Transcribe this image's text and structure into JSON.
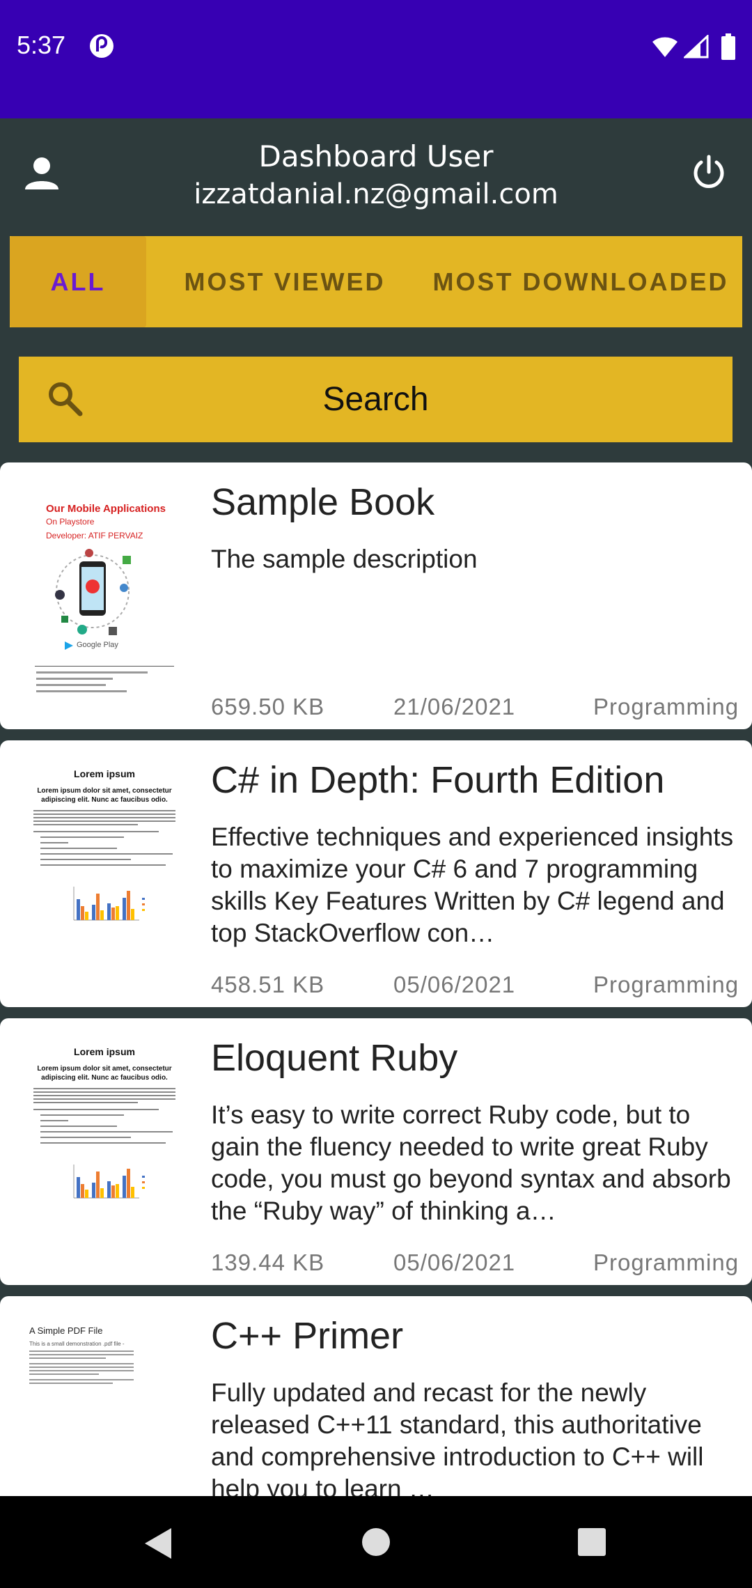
{
  "status_bar": {
    "time": "5:37"
  },
  "header": {
    "title": "Dashboard User",
    "email": "izzatdanial.nz@gmail.com"
  },
  "tabs": [
    {
      "label": "ALL",
      "active": true
    },
    {
      "label": "MOST VIEWED",
      "active": false
    },
    {
      "label": "MOST DOWNLOADED",
      "active": false
    }
  ],
  "search": {
    "label": "Search"
  },
  "books": [
    {
      "title": "Sample Book",
      "description": "The sample description",
      "size": "659.50 KB",
      "date": "21/06/2021",
      "category": "Programming",
      "thumb": {
        "heading": "Our Mobile Applications",
        "sub": "On Playstore",
        "dev": "Developer: ATIF PERVAIZ",
        "badge": "Google Play"
      }
    },
    {
      "title": "C# in Depth: Fourth Edition",
      "description": "Effective techniques and experienced insights to maximize your C# 6 and 7 programming skills  Key Features  Written by C# legend and top StackOverflow con…",
      "size": "458.51 KB",
      "date": "05/06/2021",
      "category": "Programming",
      "thumb": {
        "heading": "Lorem ipsum",
        "sub": "Lorem ipsum dolor sit amet, consectetur adipiscing elit. Nunc ac faucibus odio."
      }
    },
    {
      "title": "Eloquent Ruby",
      "description": "It’s easy to write correct Ruby code, but to gain the fluency needed to write great Ruby code, you must go beyond syntax and absorb the “Ruby way” of thinking a…",
      "size": "139.44 KB",
      "date": "05/06/2021",
      "category": "Programming",
      "thumb": {
        "heading": "Lorem ipsum",
        "sub": "Lorem ipsum dolor sit amet, consectetur adipiscing elit. Nunc ac faucibus odio."
      }
    },
    {
      "title": "C++ Primer",
      "description": "Fully updated and recast for the newly released C++11 standard, this authoritative and comprehensive introduction to C++ will help you to learn …",
      "size": "",
      "date": "",
      "category": "",
      "thumb": {
        "heading": "A Simple PDF File",
        "sub": "This is a small demonstration .pdf file -"
      }
    }
  ],
  "colors": {
    "status_bar": "#3700b3",
    "toolbar": "#2e3b3c",
    "accent": "#e3b624",
    "active_tab_text": "#6a1bd1"
  }
}
